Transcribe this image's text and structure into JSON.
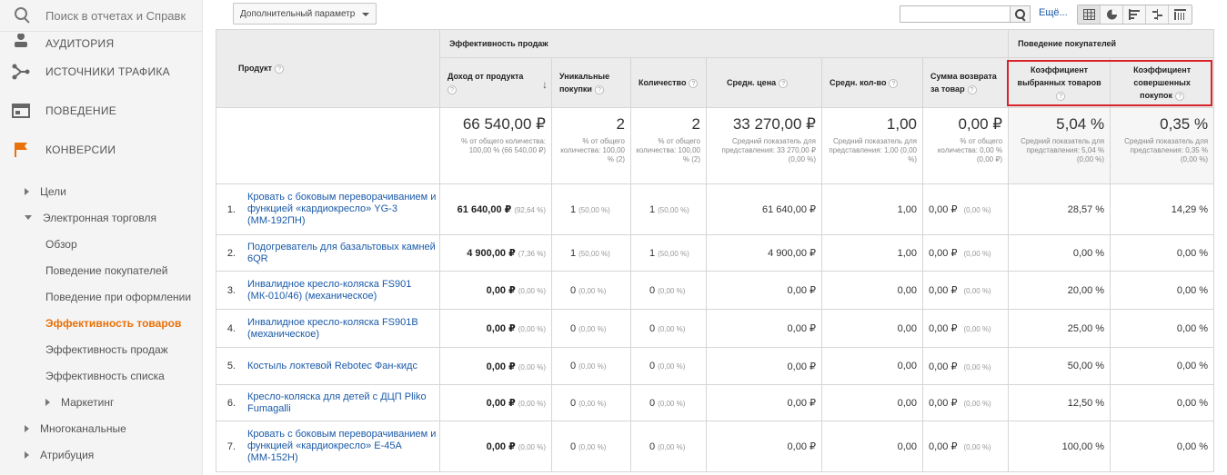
{
  "sidebar": {
    "search_placeholder": "Поиск в отчетах и Справк",
    "main_items": [
      {
        "label": "АУДИТОРИЯ",
        "icon": "person-icon"
      },
      {
        "label": "ИСТОЧНИКИ ТРАФИКА",
        "icon": "acquisition-icon"
      },
      {
        "label": "ПОВЕДЕНИЕ",
        "icon": "behavior-icon"
      },
      {
        "label": "КОНВЕРСИИ",
        "icon": "flag-icon"
      }
    ],
    "sub_items": [
      {
        "label": "Цели"
      },
      {
        "label": "Электронная торговля"
      },
      {
        "label": "Обзор"
      },
      {
        "label": "Поведение покупателей"
      },
      {
        "label": "Поведение при оформлении"
      },
      {
        "label": "Эффективность товаров"
      },
      {
        "label": "Эффективность продаж"
      },
      {
        "label": "Эффективность списка"
      },
      {
        "label": "Маркетинг"
      },
      {
        "label": "Многоканальные"
      },
      {
        "label": "Атрибуция"
      }
    ]
  },
  "toolbar": {
    "secondary_dimension": "Дополнительный параметр",
    "more": "Ещё..."
  },
  "table": {
    "group_headers": {
      "sales": "Эффективность продаж",
      "shopping": "Поведение покупателей"
    },
    "columns": {
      "product": "Продукт",
      "revenue": "Доход от продукта",
      "unique": "Уникальные покупки",
      "qty": "Количество",
      "avg_price": "Средн. цена",
      "avg_qty": "Средн. кол-во",
      "refund": "Сумма возврата за товар",
      "cart_rate": "Коэффициент выбранных товаров",
      "buy_rate": "Коэффициент совершенных покупок"
    },
    "totals": {
      "revenue": "66 540,00 ₽",
      "revenue_sub": "% от общего количества: 100,00 % (66 540,00 ₽)",
      "unique": "2",
      "unique_sub": "% от общего количества: 100,00 % (2)",
      "qty": "2",
      "qty_sub": "% от общего количества: 100,00 % (2)",
      "avg_price": "33 270,00 ₽",
      "avg_price_sub": "Средний показатель для представления: 33 270,00 ₽ (0,00 %)",
      "avg_qty": "1,00",
      "avg_qty_sub": "Средний показатель для представления: 1,00 (0,00 %)",
      "refund": "0,00 ₽",
      "refund_sub": "% от общего количества: 0,00 % (0,00 ₽)",
      "cart_rate": "5,04 %",
      "cart_rate_sub": "Средний показатель для представления: 5,04 % (0,00 %)",
      "buy_rate": "0,35 %",
      "buy_rate_sub": "Средний показатель для представления: 0,35 % (0,00 %)"
    },
    "rows": [
      {
        "idx": "1.",
        "name": "Кровать с боковым переворачиванием и функцией «кардиокресло» YG-3 (ММ-192ПН)",
        "revenue": "61 640,00 ₽",
        "revenue_pct": "(92,64 %)",
        "unique": "1",
        "unique_pct": "(50,00 %)",
        "qty": "1",
        "qty_pct": "(50,00 %)",
        "avg_price": "61 640,00 ₽",
        "avg_qty": "1,00",
        "refund": "0,00 ₽",
        "refund_pct": "(0,00 %)",
        "cart_rate": "28,57 %",
        "buy_rate": "14,29 %"
      },
      {
        "idx": "2.",
        "name": "Подогреватель для базальтовых камней 6QR",
        "revenue": "4 900,00 ₽",
        "revenue_pct": "(7,36 %)",
        "unique": "1",
        "unique_pct": "(50,00 %)",
        "qty": "1",
        "qty_pct": "(50,00 %)",
        "avg_price": "4 900,00 ₽",
        "avg_qty": "1,00",
        "refund": "0,00 ₽",
        "refund_pct": "(0,00 %)",
        "cart_rate": "0,00 %",
        "buy_rate": "0,00 %"
      },
      {
        "idx": "3.",
        "name": "Инвалидное кресло-коляска FS901 (МК-010/46) (механическое)",
        "revenue": "0,00 ₽",
        "revenue_pct": "(0,00 %)",
        "unique": "0",
        "unique_pct": "(0,00 %)",
        "qty": "0",
        "qty_pct": "(0,00 %)",
        "avg_price": "0,00 ₽",
        "avg_qty": "0,00",
        "refund": "0,00 ₽",
        "refund_pct": "(0,00 %)",
        "cart_rate": "20,00 %",
        "buy_rate": "0,00 %"
      },
      {
        "idx": "4.",
        "name": "Инвалидное кресло-коляска FS901B (механическое)",
        "revenue": "0,00 ₽",
        "revenue_pct": "(0,00 %)",
        "unique": "0",
        "unique_pct": "(0,00 %)",
        "qty": "0",
        "qty_pct": "(0,00 %)",
        "avg_price": "0,00 ₽",
        "avg_qty": "0,00",
        "refund": "0,00 ₽",
        "refund_pct": "(0,00 %)",
        "cart_rate": "25,00 %",
        "buy_rate": "0,00 %"
      },
      {
        "idx": "5.",
        "name": "Костыль локтевой Rebotec Фан-кидс",
        "revenue": "0,00 ₽",
        "revenue_pct": "(0,00 %)",
        "unique": "0",
        "unique_pct": "(0,00 %)",
        "qty": "0",
        "qty_pct": "(0,00 %)",
        "avg_price": "0,00 ₽",
        "avg_qty": "0,00",
        "refund": "0,00 ₽",
        "refund_pct": "(0,00 %)",
        "cart_rate": "50,00 %",
        "buy_rate": "0,00 %"
      },
      {
        "idx": "6.",
        "name": "Кресло-коляска для детей с ДЦП Pliko Fumagalli",
        "revenue": "0,00 ₽",
        "revenue_pct": "(0,00 %)",
        "unique": "0",
        "unique_pct": "(0,00 %)",
        "qty": "0",
        "qty_pct": "(0,00 %)",
        "avg_price": "0,00 ₽",
        "avg_qty": "0,00",
        "refund": "0,00 ₽",
        "refund_pct": "(0,00 %)",
        "cart_rate": "12,50 %",
        "buy_rate": "0,00 %"
      },
      {
        "idx": "7.",
        "name": "Кровать с боковым переворачиванием и функцией «кардиокресло» Е-45А (ММ-152Н)",
        "revenue": "0,00 ₽",
        "revenue_pct": "(0,00 %)",
        "unique": "0",
        "unique_pct": "(0,00 %)",
        "qty": "0",
        "qty_pct": "(0,00 %)",
        "avg_price": "0,00 ₽",
        "avg_qty": "0,00",
        "refund": "0,00 ₽",
        "refund_pct": "(0,00 %)",
        "cart_rate": "100,00 %",
        "buy_rate": "0,00 %"
      }
    ]
  },
  "colors": {
    "accent": "#e8710a",
    "link": "#1a5aa8",
    "highlight": "#d9232a"
  }
}
